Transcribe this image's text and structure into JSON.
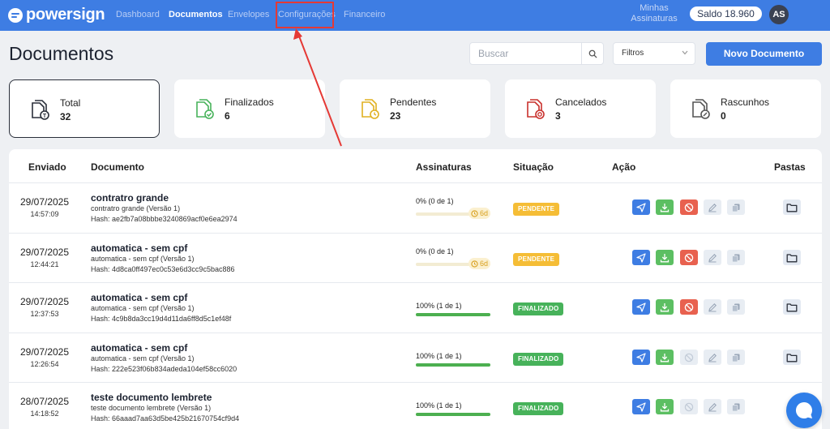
{
  "brand": {
    "name": "powersign"
  },
  "nav": {
    "items": [
      {
        "label": "Dashboard",
        "active": false
      },
      {
        "label": "Documentos",
        "active": true
      },
      {
        "label": "Envelopes",
        "active": false
      },
      {
        "label": "Configurações",
        "active": false
      },
      {
        "label": "Financeiro",
        "active": false
      }
    ],
    "minhas_assinaturas": "Minhas Assinaturas",
    "saldo": "Saldo 18.960",
    "avatar_initials": "AS"
  },
  "page": {
    "title": "Documentos",
    "search_placeholder": "Buscar",
    "filter_label": "Filtros",
    "new_document_label": "Novo Documento"
  },
  "stats": [
    {
      "label": "Total",
      "value": "32",
      "color": "#2a2f3a"
    },
    {
      "label": "Finalizados",
      "value": "6",
      "color": "#47b25a"
    },
    {
      "label": "Pendentes",
      "value": "23",
      "color": "#e0b020"
    },
    {
      "label": "Cancelados",
      "value": "3",
      "color": "#c9302c"
    },
    {
      "label": "Rascunhos",
      "value": "0",
      "color": "#555555"
    }
  ],
  "table": {
    "columns": [
      "Enviado",
      "Documento",
      "Assinaturas",
      "Situação",
      "Ação",
      "Pastas"
    ],
    "rows": [
      {
        "date": "29/07/2025",
        "time": "14:57:09",
        "name": "contratro grande",
        "version": "contratro grande (Versão 1)",
        "hash": "Hash: ae2fb7a08bbbe3240869acf0e6ea2974",
        "signatures": "0% (0 de 1)",
        "progress": 0,
        "days_left": "6d",
        "status": "PENDENTE",
        "status_type": "pend",
        "can_cancel": true
      },
      {
        "date": "29/07/2025",
        "time": "12:44:21",
        "name": "automatica - sem cpf",
        "version": "automatica - sem cpf (Versão 1)",
        "hash": "Hash: 4d8ca0ff497ec0c53e6d3cc9c5bac886",
        "signatures": "0% (0 de 1)",
        "progress": 0,
        "days_left": "6d",
        "status": "PENDENTE",
        "status_type": "pend",
        "can_cancel": true
      },
      {
        "date": "29/07/2025",
        "time": "12:37:53",
        "name": "automatica - sem cpf",
        "version": "automatica - sem cpf (Versão 1)",
        "hash": "Hash: 4c9b8da3cc19d4d11da6ff8d5c1ef48f",
        "signatures": "100% (1 de 1)",
        "progress": 100,
        "days_left": "",
        "status": "FINALIZADO",
        "status_type": "fin",
        "can_cancel": true
      },
      {
        "date": "29/07/2025",
        "time": "12:26:54",
        "name": "automatica - sem cpf",
        "version": "automatica - sem cpf (Versão 1)",
        "hash": "Hash: 222e523f06b834adeda104ef58cc6020",
        "signatures": "100% (1 de 1)",
        "progress": 100,
        "days_left": "",
        "status": "FINALIZADO",
        "status_type": "fin",
        "can_cancel": false
      },
      {
        "date": "28/07/2025",
        "time": "14:18:52",
        "name": "teste documento lembrete",
        "version": "teste documento lembrete (Versão 1)",
        "hash": "Hash: 66aaad7aa63d5be425b21670754cf9d4",
        "signatures": "100% (1 de 1)",
        "progress": 100,
        "days_left": "",
        "status": "FINALIZADO",
        "status_type": "fin",
        "can_cancel": false
      }
    ]
  }
}
